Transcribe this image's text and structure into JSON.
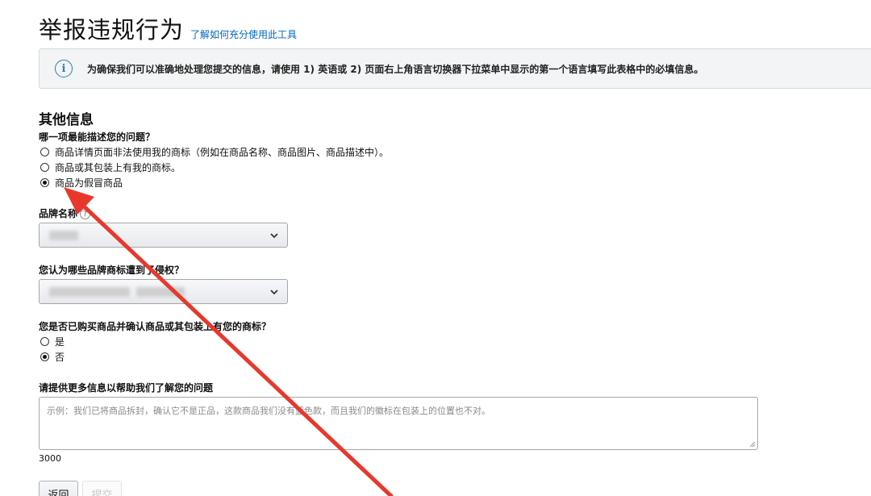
{
  "header": {
    "title": "举报违规行为",
    "help_link": "了解如何充分使用此工具"
  },
  "notice": {
    "icon": "info-icon",
    "text": "为确保我们可以准确地处理您提交的信息，请使用 1) 英语或 2) 页面右上角语言切换器下拉菜单中显示的第一个语言填写此表格中的必填信息。"
  },
  "section": {
    "title": "其他信息"
  },
  "problem_question": {
    "label": "哪一项最能描述您的问题？",
    "options": [
      {
        "label": "商品详情页面非法使用我的商标（例如在商品名称、商品图片、商品描述中）。",
        "selected": false
      },
      {
        "label": "商品或其包装上有我的商标。",
        "selected": false
      },
      {
        "label": "商品为假冒商品",
        "selected": true
      }
    ]
  },
  "brand_field": {
    "label": "品牌名称",
    "help_icon": "?"
  },
  "trademark_field": {
    "label": "您认为哪些品牌商标遭到了侵权？"
  },
  "purchase_question": {
    "label": "您是否已购买商品并确认商品或其包装上有您的商标？",
    "options": [
      {
        "label": "是",
        "selected": false
      },
      {
        "label": "否",
        "selected": true
      }
    ]
  },
  "details_field": {
    "label": "请提供更多信息以帮助我们了解您的问题",
    "placeholder": "示例：我们已将商品拆封，确认它不是正品，这款商品我们没有蓝色款，而且我们的徽标在包装上的位置也不对。",
    "char_limit": "3000"
  },
  "actions": {
    "back_label": "返回",
    "submit_label": "提交"
  },
  "colors": {
    "link": "#0066c0",
    "info_icon": "#2a7fb8",
    "annotation_arrow": "#e8382c"
  }
}
